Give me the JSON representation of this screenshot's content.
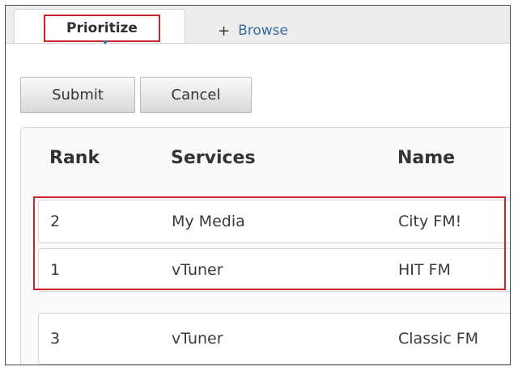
{
  "tabs": {
    "prioritize_label": "Prioritize",
    "browse_plus": "+",
    "browse_label": "Browse"
  },
  "actions": {
    "submit_label": "Submit",
    "cancel_label": "Cancel"
  },
  "table": {
    "headers": {
      "rank": "Rank",
      "services": "Services",
      "name": "Name"
    },
    "rows": [
      {
        "rank": "2",
        "service": "My Media",
        "name": "City FM!"
      },
      {
        "rank": "1",
        "service": "vTuner",
        "name": "HIT FM"
      },
      {
        "rank": "3",
        "service": "vTuner",
        "name": "Classic FM"
      }
    ]
  },
  "colors": {
    "highlight": "#c9232d",
    "link": "#3c6aa1"
  }
}
